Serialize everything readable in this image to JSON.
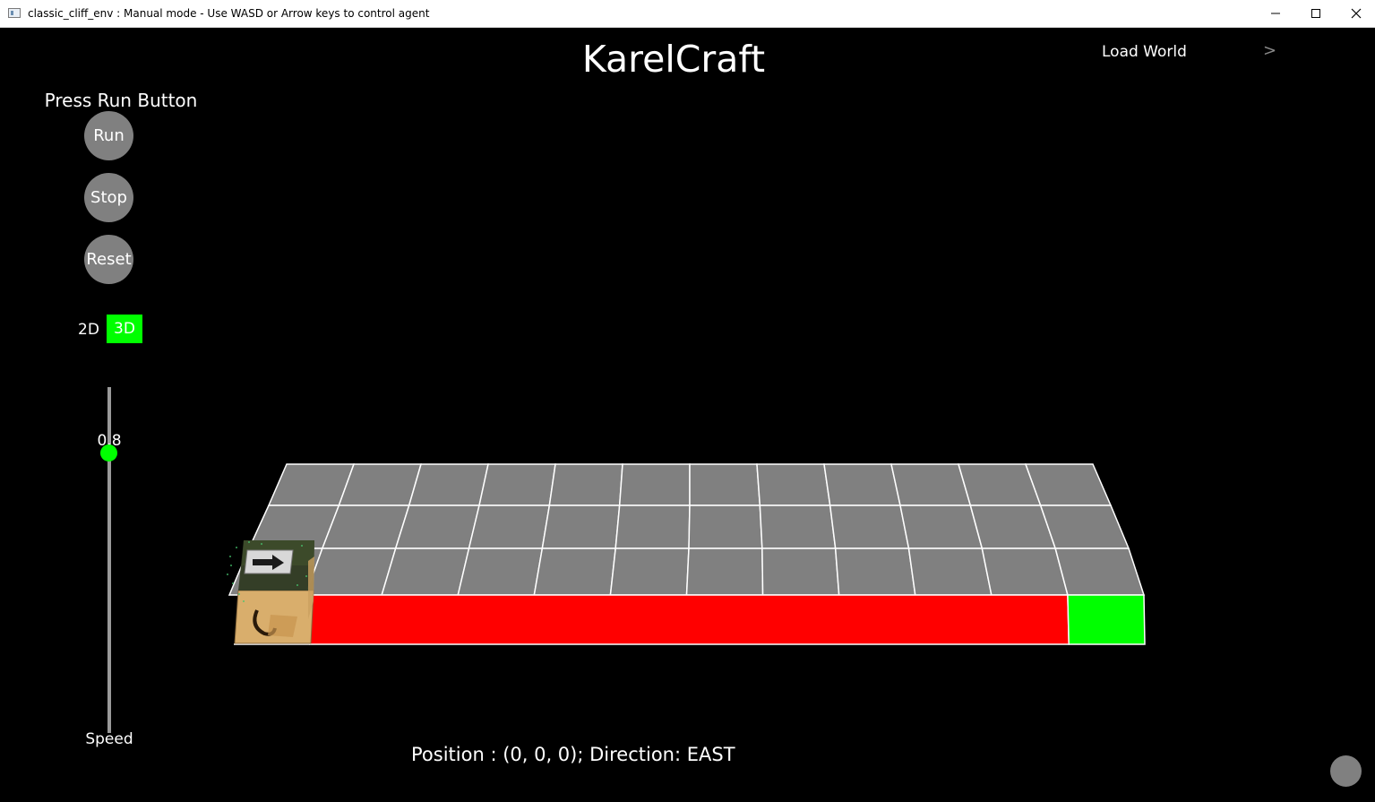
{
  "window": {
    "title": "classic_cliff_env : Manual mode - Use WASD or Arrow keys to control agent",
    "controls": [
      "minimize-icon",
      "maximize-icon",
      "close-icon"
    ]
  },
  "app": {
    "title": "KarelCraft",
    "load_world": "Load World",
    "load_world_arrow": ">"
  },
  "sidebar": {
    "status": "Press Run Button",
    "run_label": "Run",
    "stop_label": "Stop",
    "reset_label": "Reset",
    "mode_2d": "2D",
    "mode_3d": "3D",
    "active_mode": "3D",
    "speed_value": "0.8",
    "speed_label": "Speed",
    "speed_fraction": 0.8
  },
  "world": {
    "columns": 12,
    "rows": 4,
    "tile_color": "#808080",
    "cliff_color": "#ff0000",
    "goal_color": "#00ff00",
    "agent_direction": "EAST",
    "agent_icon": "arrow-right-icon"
  },
  "footer": {
    "position": "Position : (0, 0, 0); Direction: EAST"
  },
  "colors": {
    "accent": "#00ff00",
    "button": "#808080",
    "background": "#000000"
  }
}
